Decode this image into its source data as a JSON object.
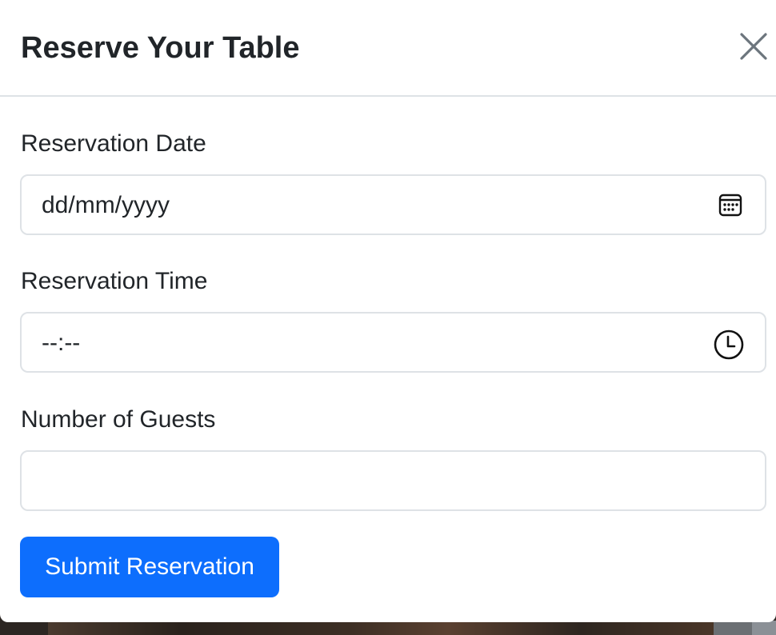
{
  "modal": {
    "title": "Reserve Your Table",
    "close_icon": "close-icon"
  },
  "form": {
    "date": {
      "label": "Reservation Date",
      "placeholder": "dd/mm/yyyy",
      "icon": "calendar-icon"
    },
    "time": {
      "label": "Reservation Time",
      "placeholder": "--:--",
      "icon": "clock-icon"
    },
    "guests": {
      "label": "Number of Guests",
      "value": ""
    },
    "submit_label": "Submit Reservation"
  },
  "colors": {
    "primary": "#0d6efd",
    "text": "#212529",
    "border": "#dee2e6"
  }
}
